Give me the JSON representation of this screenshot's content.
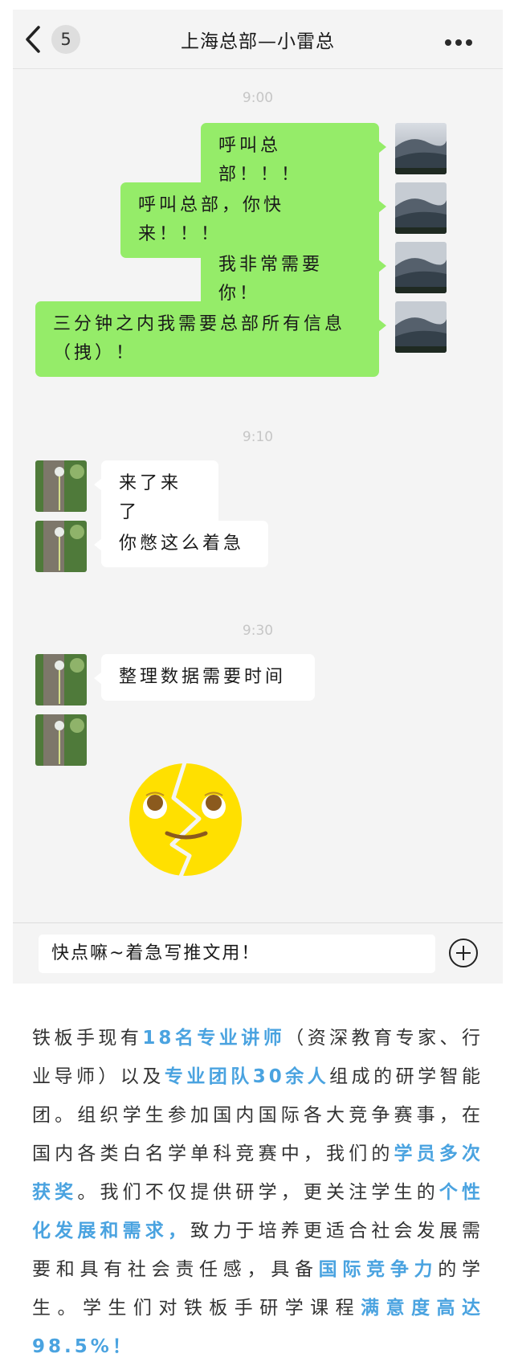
{
  "header": {
    "unread_count": "5",
    "title": "上海总部—小雷总"
  },
  "messages": [
    {
      "type": "time",
      "text": "9:00"
    },
    {
      "type": "sent",
      "text": "呼叫总部！！！"
    },
    {
      "type": "sent",
      "text": "呼叫总部，你快来！！！"
    },
    {
      "type": "sent",
      "text": "我非常需要你！"
    },
    {
      "type": "sent",
      "text": "三分钟之内我需要总部所有信息（拽）！"
    },
    {
      "type": "time",
      "text": "9:10"
    },
    {
      "type": "received",
      "text": "来了来了"
    },
    {
      "type": "received",
      "text": "你憋这么着急"
    },
    {
      "type": "time",
      "text": "9:30"
    },
    {
      "type": "received",
      "text": "整理数据需要时间"
    },
    {
      "type": "received_sticker",
      "sticker": "broken-face-rolling-eyes-emoji"
    }
  ],
  "input": {
    "value": "快点嘛~着急写推文用！"
  },
  "article": {
    "segments": [
      {
        "text": "铁板手现有",
        "highlight": false
      },
      {
        "text": "18名专业讲师",
        "highlight": true
      },
      {
        "text": "（资深教育专家、行业导师）以及",
        "highlight": false
      },
      {
        "text": "专业团队30余人",
        "highlight": true
      },
      {
        "text": "组成的研学智能团。组织学生参加国内国际各大竞争赛事，在国内各类白名学单科竞赛中，我们的",
        "highlight": false
      },
      {
        "text": "学员多次获奖",
        "highlight": true
      },
      {
        "text": "。我们不仅提供研学，更关注学生的",
        "highlight": false
      },
      {
        "text": "个性化发展和需求，",
        "highlight": true
      },
      {
        "text": "致力于培养更适合社会发展需要和具有社会责任感，具备",
        "highlight": false
      },
      {
        "text": "国际竞争力",
        "highlight": true
      },
      {
        "text": "的学生。学生们对铁板手研学课程",
        "highlight": false
      },
      {
        "text": "满意度高达98.5%！",
        "highlight": true
      }
    ]
  },
  "colors": {
    "sent_bubble": "#95ec69",
    "received_bubble": "#ffffff",
    "chat_bg": "#f4f4f4",
    "highlight": "#4aa3e0"
  }
}
